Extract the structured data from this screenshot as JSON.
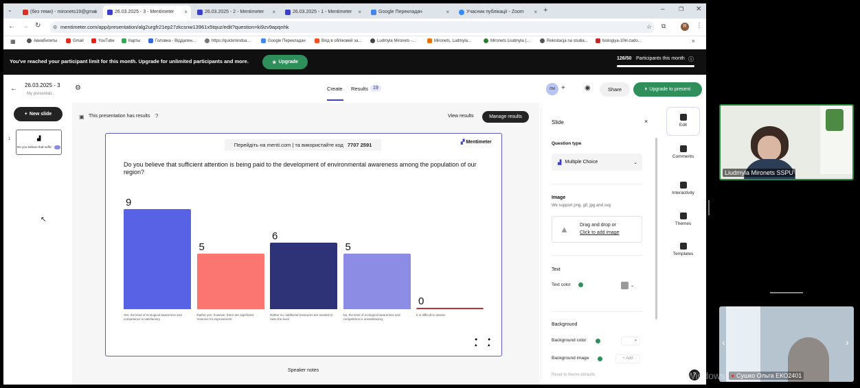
{
  "browser": {
    "tabs": [
      {
        "label": "(без теми) - mironets19@gmai",
        "favicon_color": "#d93025"
      },
      {
        "label": "26.03.2025 - 3 - Mentimeter",
        "favicon_color": "#3b3fce"
      },
      {
        "label": "26.03.2025 - 2 - Mentimeter",
        "favicon_color": "#3b3fce"
      },
      {
        "label": "26.03.2025 - 1 - Mentimeter",
        "favicon_color": "#3b3fce"
      },
      {
        "label": "Google Перекладач",
        "favicon_color": "#4285f4"
      },
      {
        "label": "Учасник публікації - Zoom",
        "favicon_color": "#2d8cff"
      }
    ],
    "url": "mentimeter.com/app/presentation/alg2urgfr21ep27zkcsnw13961x5tquz/edit?question=ki9zv9apqnhk",
    "bookmarks": [
      "Авиабилеты",
      "Gmail",
      "YouTube",
      "Карты",
      "Головна - Віддален...",
      "https://quickmindsa...",
      "Google Перекладач",
      "Вхід в обліковий за...",
      "Ludmyla Mironets -...",
      "Mironets, Ludmyla...",
      "Mironets Liudmyla (...",
      "Rekrutacja na studia...",
      "biologiya-10kl-zado..."
    ],
    "profile_initial": "R"
  },
  "banner": {
    "message": "You've reached your participant limit for this month. Upgrade for unlimited participants and more.",
    "upgrade_label": "Upgrade",
    "participants_count": "126/50",
    "participants_label": "Participants this month"
  },
  "header": {
    "title": "26.03.2025 - 3",
    "subtitle": "My presentati...",
    "tab_create": "Create",
    "tab_results": "Results",
    "results_count": "19",
    "avatar_initials": "ЛМ",
    "share_label": "Share",
    "upgrade_present_label": "Upgrade to present"
  },
  "left": {
    "new_slide_label": "New slide",
    "slide_number": "1",
    "slide_thumb_text": "Do you believe that suffic"
  },
  "canvas": {
    "has_results_text": "This presentation has results",
    "view_results_label": "View results",
    "manage_results_label": "Manage results",
    "join_text": "Перейдіть на menti.com | та використайте код",
    "join_code": "7707 2591",
    "brand": "Mentimeter",
    "question": "Do you believe that sufficient attention is being paid to the development of environmental awareness among the population of our region?",
    "speaker_notes": "Speaker notes"
  },
  "chart_data": {
    "type": "bar",
    "categories": [
      "Yes, the level of ecological awareness and competence is satisfactory",
      "Rather yes, however, there are significant reserves for improvement",
      "Rather no, additional measures are needed to raise the level",
      "No, the level of ecological awareness and competence is unsatisfactory",
      "It is difficult to assess"
    ],
    "values": [
      9,
      5,
      6,
      5,
      0
    ],
    "colors": [
      "#5763e4",
      "#fb7671",
      "#2e3277",
      "#8d8ce4",
      "#b5323e"
    ],
    "ylim": [
      0,
      9
    ]
  },
  "panel": {
    "title": "Slide",
    "question_type_label": "Question type",
    "question_type_value": "Multiple Choice",
    "image_label": "Image",
    "image_hint": "We support png, gif, jpg and svg",
    "drag_text": "Drag and drop or",
    "click_text": "Click to add image",
    "text_label": "Text",
    "text_color_label": "Text color",
    "background_label": "Background",
    "bg_color_label": "Background color",
    "bg_image_label": "Background image",
    "add_label": "Add",
    "reset_label": "Reset to theme defaults"
  },
  "rail": {
    "edit": "Edit",
    "comments": "Comments",
    "interactivity": "Interactivity",
    "themes": "Themes",
    "templates": "Templates"
  },
  "zoom": {
    "speaker_name": "Liudmyla Mironets SSPU",
    "participant_name": "Сушко Ольга ЕКО2401",
    "windows_watermark": "Активация Windows"
  }
}
